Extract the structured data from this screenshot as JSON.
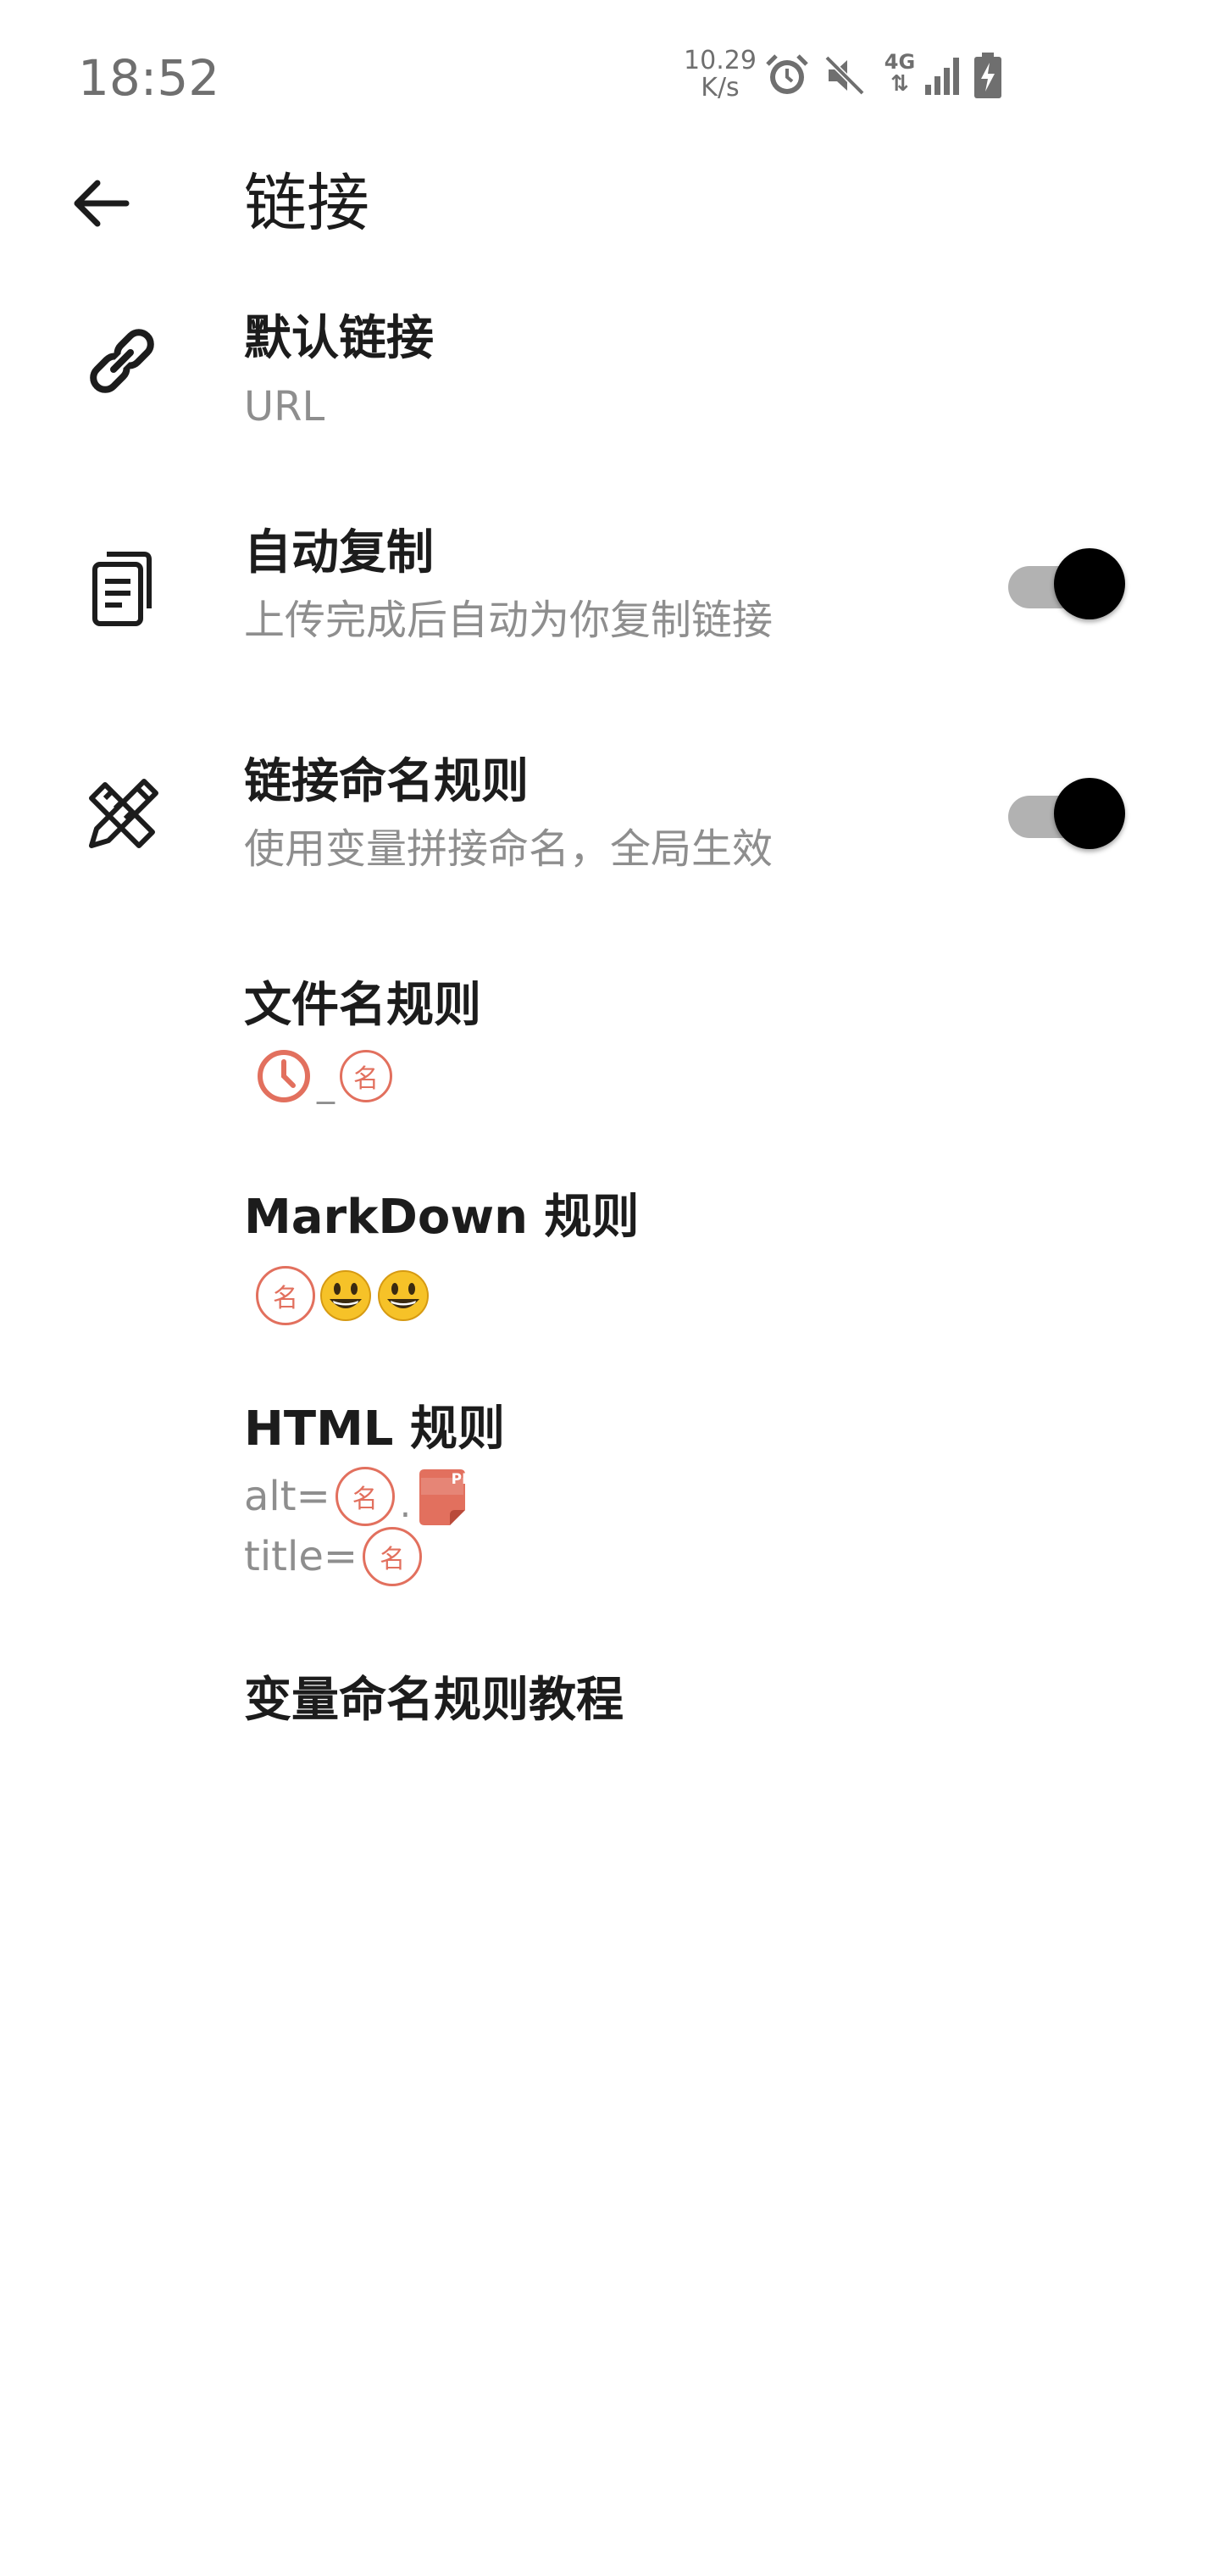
{
  "status_bar": {
    "time": "18:52",
    "net_speed_value": "10.29",
    "net_speed_unit": "K/s",
    "network_type": "4G",
    "icons": [
      "alarm-icon",
      "mute-icon",
      "4g-data-icon",
      "signal-icon",
      "battery-charging-icon"
    ]
  },
  "header": {
    "title": "链接",
    "back_icon": "arrow-left-icon"
  },
  "settings": {
    "default_link": {
      "title": "默认链接",
      "subtitle": "URL",
      "icon": "link-icon"
    },
    "auto_copy": {
      "title": "自动复制",
      "subtitle": "上传完成后自动为你复制链接",
      "icon": "clipboard-icon",
      "enabled": true
    },
    "naming_rule": {
      "title": "链接命名规则",
      "subtitle": "使用变量拼接命名，全局生效",
      "icon": "pencil-ruler-icon",
      "enabled": true
    },
    "filename_rule": {
      "title": "文件名规则",
      "separator": "_",
      "tokens": [
        "clock-token-icon",
        "name-token"
      ]
    },
    "markdown_rule": {
      "title": "MarkDown 规则",
      "tokens": [
        "name-token",
        "emoji-smile-icon",
        "emoji-smile-icon"
      ]
    },
    "html_rule": {
      "title": "HTML 规则",
      "alt_label": "alt=",
      "alt_separator": ".",
      "title_label": "title=",
      "png_badge": "PNG"
    },
    "tutorial": {
      "title": "变量命名规则教程"
    }
  },
  "token": {
    "name_char": "名"
  },
  "colors": {
    "accent": "#e2705e",
    "toggle_track": "#b2b2b2",
    "toggle_thumb": "#000000",
    "subtitle": "#8e8e8e",
    "emoji": "#f6c228"
  }
}
